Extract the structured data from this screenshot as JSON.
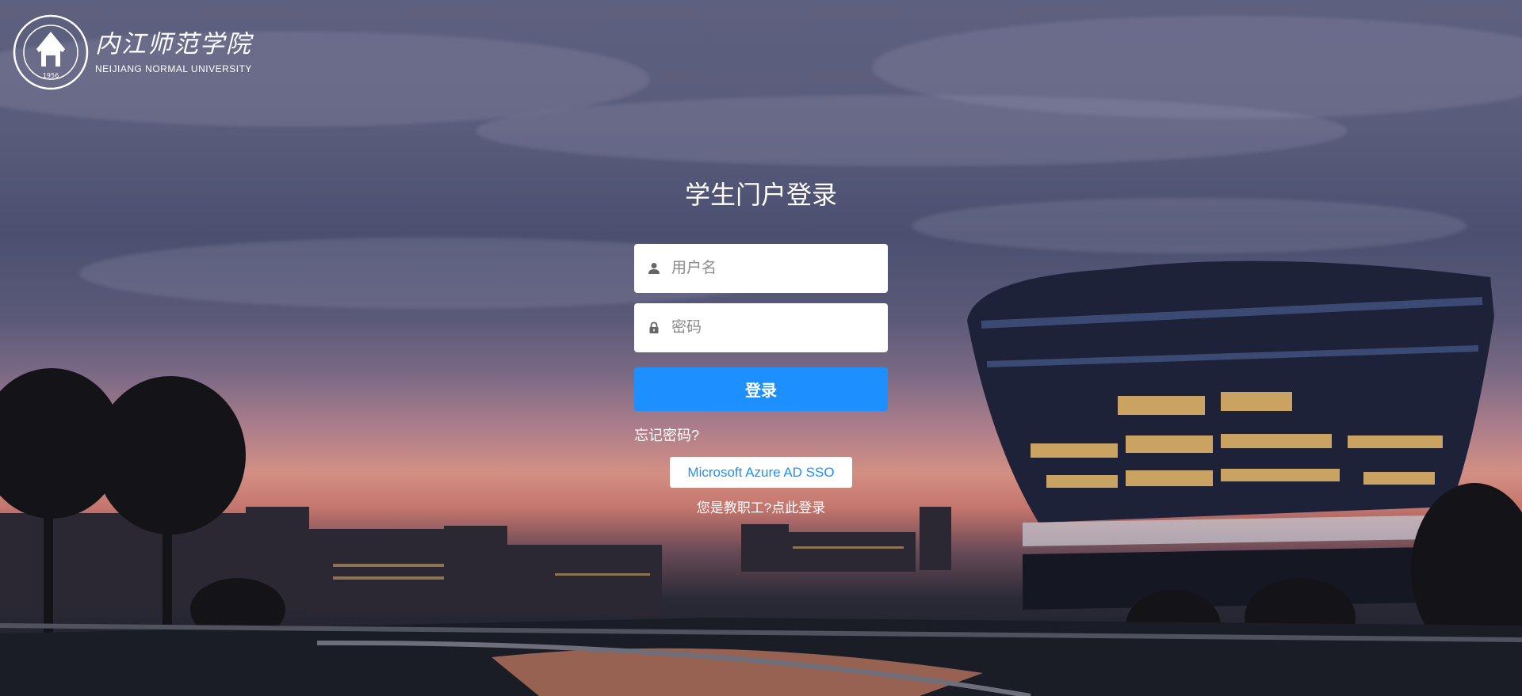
{
  "brand": {
    "name_cn": "内江师范学院",
    "name_en": "NEIJIANG NORMAL UNIVERSITY",
    "seal_year": "1956"
  },
  "login": {
    "title": "学生门户登录",
    "username_placeholder": "用户名",
    "password_placeholder": "密码",
    "submit_label": "登录",
    "forgot_label": "忘记密码?",
    "sso_label": "Microsoft Azure AD SSO",
    "staff_prompt": "您是教职工?",
    "staff_link": "点此登录"
  },
  "icons": {
    "username": "user-icon",
    "password": "lock-icon"
  },
  "colors": {
    "accent": "#1e8fff",
    "text_light": "#ffffff"
  }
}
